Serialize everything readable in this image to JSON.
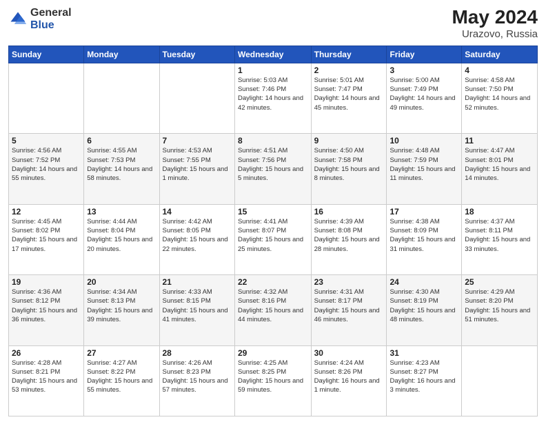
{
  "header": {
    "logo_general": "General",
    "logo_blue": "Blue",
    "title": "May 2024",
    "location": "Urazovo, Russia"
  },
  "weekdays": [
    "Sunday",
    "Monday",
    "Tuesday",
    "Wednesday",
    "Thursday",
    "Friday",
    "Saturday"
  ],
  "weeks": [
    [
      {
        "day": "",
        "info": ""
      },
      {
        "day": "",
        "info": ""
      },
      {
        "day": "",
        "info": ""
      },
      {
        "day": "1",
        "info": "Sunrise: 5:03 AM\nSunset: 7:46 PM\nDaylight: 14 hours\nand 42 minutes."
      },
      {
        "day": "2",
        "info": "Sunrise: 5:01 AM\nSunset: 7:47 PM\nDaylight: 14 hours\nand 45 minutes."
      },
      {
        "day": "3",
        "info": "Sunrise: 5:00 AM\nSunset: 7:49 PM\nDaylight: 14 hours\nand 49 minutes."
      },
      {
        "day": "4",
        "info": "Sunrise: 4:58 AM\nSunset: 7:50 PM\nDaylight: 14 hours\nand 52 minutes."
      }
    ],
    [
      {
        "day": "5",
        "info": "Sunrise: 4:56 AM\nSunset: 7:52 PM\nDaylight: 14 hours\nand 55 minutes."
      },
      {
        "day": "6",
        "info": "Sunrise: 4:55 AM\nSunset: 7:53 PM\nDaylight: 14 hours\nand 58 minutes."
      },
      {
        "day": "7",
        "info": "Sunrise: 4:53 AM\nSunset: 7:55 PM\nDaylight: 15 hours\nand 1 minute."
      },
      {
        "day": "8",
        "info": "Sunrise: 4:51 AM\nSunset: 7:56 PM\nDaylight: 15 hours\nand 5 minutes."
      },
      {
        "day": "9",
        "info": "Sunrise: 4:50 AM\nSunset: 7:58 PM\nDaylight: 15 hours\nand 8 minutes."
      },
      {
        "day": "10",
        "info": "Sunrise: 4:48 AM\nSunset: 7:59 PM\nDaylight: 15 hours\nand 11 minutes."
      },
      {
        "day": "11",
        "info": "Sunrise: 4:47 AM\nSunset: 8:01 PM\nDaylight: 15 hours\nand 14 minutes."
      }
    ],
    [
      {
        "day": "12",
        "info": "Sunrise: 4:45 AM\nSunset: 8:02 PM\nDaylight: 15 hours\nand 17 minutes."
      },
      {
        "day": "13",
        "info": "Sunrise: 4:44 AM\nSunset: 8:04 PM\nDaylight: 15 hours\nand 20 minutes."
      },
      {
        "day": "14",
        "info": "Sunrise: 4:42 AM\nSunset: 8:05 PM\nDaylight: 15 hours\nand 22 minutes."
      },
      {
        "day": "15",
        "info": "Sunrise: 4:41 AM\nSunset: 8:07 PM\nDaylight: 15 hours\nand 25 minutes."
      },
      {
        "day": "16",
        "info": "Sunrise: 4:39 AM\nSunset: 8:08 PM\nDaylight: 15 hours\nand 28 minutes."
      },
      {
        "day": "17",
        "info": "Sunrise: 4:38 AM\nSunset: 8:09 PM\nDaylight: 15 hours\nand 31 minutes."
      },
      {
        "day": "18",
        "info": "Sunrise: 4:37 AM\nSunset: 8:11 PM\nDaylight: 15 hours\nand 33 minutes."
      }
    ],
    [
      {
        "day": "19",
        "info": "Sunrise: 4:36 AM\nSunset: 8:12 PM\nDaylight: 15 hours\nand 36 minutes."
      },
      {
        "day": "20",
        "info": "Sunrise: 4:34 AM\nSunset: 8:13 PM\nDaylight: 15 hours\nand 39 minutes."
      },
      {
        "day": "21",
        "info": "Sunrise: 4:33 AM\nSunset: 8:15 PM\nDaylight: 15 hours\nand 41 minutes."
      },
      {
        "day": "22",
        "info": "Sunrise: 4:32 AM\nSunset: 8:16 PM\nDaylight: 15 hours\nand 44 minutes."
      },
      {
        "day": "23",
        "info": "Sunrise: 4:31 AM\nSunset: 8:17 PM\nDaylight: 15 hours\nand 46 minutes."
      },
      {
        "day": "24",
        "info": "Sunrise: 4:30 AM\nSunset: 8:19 PM\nDaylight: 15 hours\nand 48 minutes."
      },
      {
        "day": "25",
        "info": "Sunrise: 4:29 AM\nSunset: 8:20 PM\nDaylight: 15 hours\nand 51 minutes."
      }
    ],
    [
      {
        "day": "26",
        "info": "Sunrise: 4:28 AM\nSunset: 8:21 PM\nDaylight: 15 hours\nand 53 minutes."
      },
      {
        "day": "27",
        "info": "Sunrise: 4:27 AM\nSunset: 8:22 PM\nDaylight: 15 hours\nand 55 minutes."
      },
      {
        "day": "28",
        "info": "Sunrise: 4:26 AM\nSunset: 8:23 PM\nDaylight: 15 hours\nand 57 minutes."
      },
      {
        "day": "29",
        "info": "Sunrise: 4:25 AM\nSunset: 8:25 PM\nDaylight: 15 hours\nand 59 minutes."
      },
      {
        "day": "30",
        "info": "Sunrise: 4:24 AM\nSunset: 8:26 PM\nDaylight: 16 hours\nand 1 minute."
      },
      {
        "day": "31",
        "info": "Sunrise: 4:23 AM\nSunset: 8:27 PM\nDaylight: 16 hours\nand 3 minutes."
      },
      {
        "day": "",
        "info": ""
      }
    ]
  ]
}
